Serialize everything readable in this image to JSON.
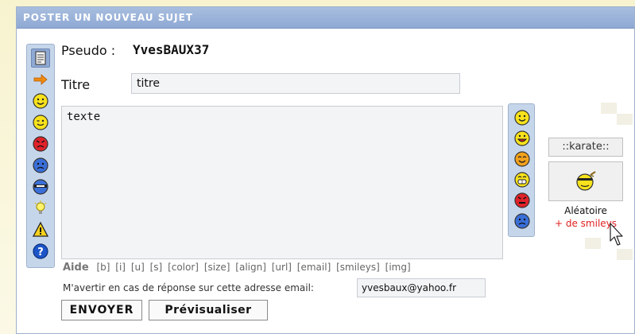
{
  "header": {
    "title": "POSTER UN NOUVEAU SUJET"
  },
  "form": {
    "pseudo_label": "Pseudo :",
    "pseudo_value": "YvesBAUX37",
    "title_label": "Titre",
    "title_value": "titre",
    "message_value": "texte"
  },
  "left_toolbar": {
    "icons": [
      "document-icon",
      "arrow-right-icon",
      "smile-icon",
      "wink-icon",
      "angry-icon",
      "sad-icon",
      "ninja-icon",
      "lightbulb-icon",
      "warning-icon",
      "question-icon"
    ]
  },
  "right_smileys": {
    "icons": [
      "smile-icon",
      "grin-icon",
      "happy-orange-icon",
      "laugh-icon",
      "mad-icon",
      "sad-icon"
    ]
  },
  "karate": {
    "label": "::karate::",
    "random_label": "Aléatoire",
    "more_smileys": "+ de smileys"
  },
  "help_bar": {
    "label": "Aide",
    "tags": [
      "[b]",
      "[i]",
      "[u]",
      "[s]",
      "[color]",
      "[size]",
      "[align]",
      "[url]",
      "[email]",
      "[smileys]",
      "[img]"
    ]
  },
  "notify": {
    "label": "M'avertir en cas de réponse sur cette adresse email:",
    "email": "yvesbaux@yahoo.fr"
  },
  "buttons": {
    "send": "ENVOYER",
    "preview": "Prévisualiser"
  },
  "colors": {
    "header_bg": "#8ea9d4",
    "toolbar_bg": "#c6d6ea",
    "accent_red": "#e02020"
  }
}
